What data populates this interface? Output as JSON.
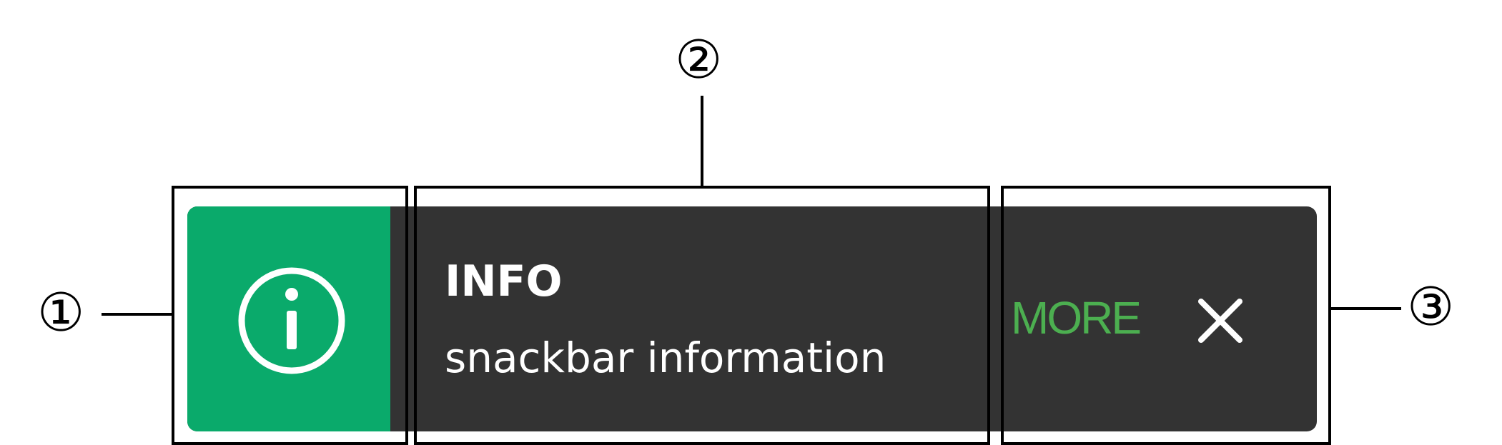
{
  "snackbar": {
    "title": "INFO",
    "message": "snackbar information",
    "action_label": "MORE",
    "icon": "info-circle-icon",
    "close_icon": "close-icon",
    "colors": {
      "background": "#333333",
      "icon_background": "#0aaa6b",
      "icon_foreground": "#ffffff",
      "text": "#ffffff",
      "action": "#4caf50",
      "close": "#ffffff"
    }
  },
  "callouts": {
    "one": "①",
    "two": "②",
    "three": "③"
  }
}
